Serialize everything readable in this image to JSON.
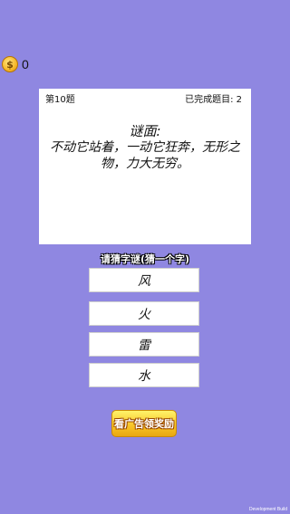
{
  "coins": {
    "icon": "coin-icon",
    "icon_glyph": "$",
    "count": "0"
  },
  "card": {
    "level": "第10题",
    "completed": "已完成题目: 2",
    "riddle_title": "谜面:",
    "riddle_text": "不动它站着，一动它狂奔，无形之物，力大无穷。"
  },
  "hint": "请猜字谜(猜一个字)",
  "options": [
    "风",
    "火",
    "雷",
    "水"
  ],
  "ad_button": "看广告领奖励",
  "dev_build": "Development Build"
}
